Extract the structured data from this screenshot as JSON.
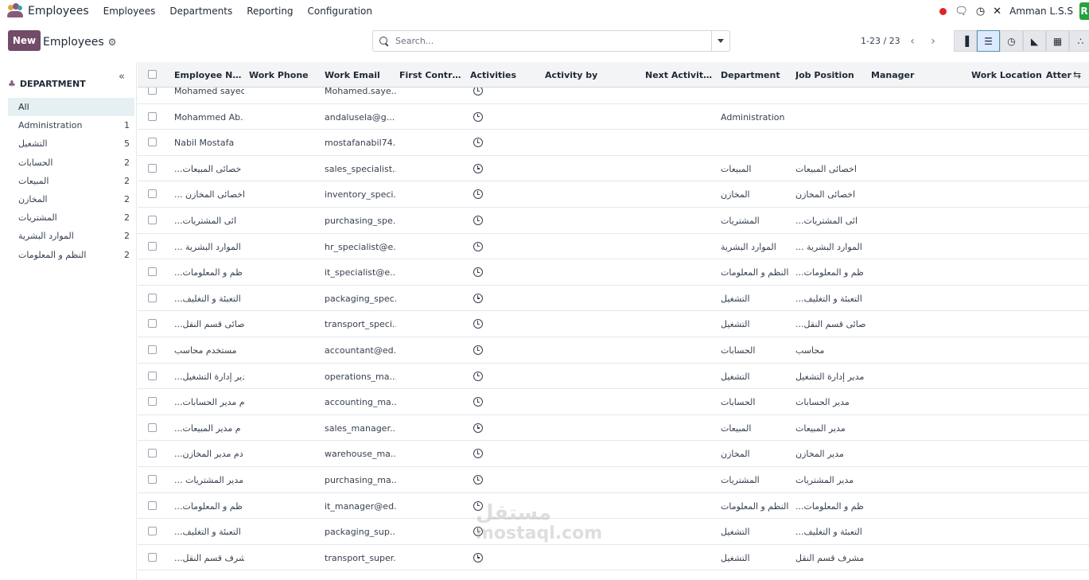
{
  "topnav": {
    "app_name": "Employees",
    "menu": [
      "Employees",
      "Departments",
      "Reporting",
      "Configuration"
    ],
    "company": "Amman L.S.S",
    "avatar_letter": "R"
  },
  "control": {
    "new_label": "New",
    "breadcrumb": "Employees",
    "search_placeholder": "Search...",
    "pager": "1-23 / 23"
  },
  "sidebar": {
    "header": "DEPARTMENT",
    "items": [
      {
        "label": "All",
        "count": ""
      },
      {
        "label": "Administration",
        "count": "1"
      },
      {
        "label": "التشغيل",
        "count": "5"
      },
      {
        "label": "الحسابات",
        "count": "2"
      },
      {
        "label": "المبيعات",
        "count": "2"
      },
      {
        "label": "المخازن",
        "count": "2"
      },
      {
        "label": "المشتريات",
        "count": "2"
      },
      {
        "label": "الموارد البشرية",
        "count": "2"
      },
      {
        "label": "النظم و المعلومات",
        "count": "2"
      }
    ]
  },
  "table": {
    "columns": [
      "Employee Name",
      "Work Phone",
      "Work Email",
      "First Contract ...",
      "Activities",
      "Activity by",
      "Next Activity D...",
      "Department",
      "Job Position",
      "Manager",
      "Work Location",
      "Atter"
    ],
    "rows": [
      {
        "name": "Mohamed sayed",
        "email": "Mohamed.saye...",
        "department": "",
        "job": ""
      },
      {
        "name": "Mohammed Ab...",
        "email": "andalusela@g...",
        "department": "Administration",
        "job": ""
      },
      {
        "name": "Nabil Mostafa",
        "email": "mostafanabil74...",
        "department": "",
        "job": ""
      },
      {
        "name": "...خصائى المبيعات",
        "email": "sales_specialist...",
        "department": "المبيعات",
        "job": "اخصائى المبيعات"
      },
      {
        "name": "... اخصائى المخازن",
        "email": "inventory_speci...",
        "department": "المخازن",
        "job": "اخصائى المخازن"
      },
      {
        "name": "...ائى المشتريات",
        "email": "purchasing_spe...",
        "department": "المشتريات",
        "job": "...ائى المشتريات"
      },
      {
        "name": "... الموارد البشرية",
        "email": "hr_specialist@e...",
        "department": "الموارد البشرية",
        "job": "... الموارد البشرية"
      },
      {
        "name": "...ظم و المعلومات",
        "email": "it_specialist@e...",
        "department": "النظم و المعلومات",
        "job": "...ظم و المعلومات"
      },
      {
        "name": "...التعبئة و التغليف",
        "email": "packaging_spec...",
        "department": "التشغيل",
        "job": "...التعبئة و التغليف"
      },
      {
        "name": "...صائى قسم النقل",
        "email": "transport_speci...",
        "department": "التشغيل",
        "job": "...صائى قسم النقل"
      },
      {
        "name": "مستخدم محاسب",
        "email": "accountant@ed...",
        "department": "الحسابات",
        "job": "محاسب"
      },
      {
        "name": "...دير إدارة التشغيل",
        "email": "operations_ma...",
        "department": "التشغيل",
        "job": "مدير إدارة التشغيل"
      },
      {
        "name": "...م مدير الحسابات",
        "email": "accounting_ma...",
        "department": "الحسابات",
        "job": "مدير الحسابات"
      },
      {
        "name": "...م مدير المبيعات",
        "email": "sales_manager...",
        "department": "المبيعات",
        "job": "مدير المبيعات"
      },
      {
        "name": "...دم مدير المخازن",
        "email": "warehouse_ma...",
        "department": "المخازن",
        "job": "مدير المخازن"
      },
      {
        "name": "... مدير المشتريات",
        "email": "purchasing_ma...",
        "department": "المشتريات",
        "job": "مدير المشتريات"
      },
      {
        "name": "...ظم و المعلومات",
        "email": "it_manager@ed...",
        "department": "النظم و المعلومات",
        "job": "...ظم و المعلومات"
      },
      {
        "name": "...التعبئة و التغليف",
        "email": "packaging_sup...",
        "department": "التشغيل",
        "job": "...التعبئة و التغليف"
      },
      {
        "name": "...شرف قسم النقل",
        "email": "transport_super...",
        "department": "التشغيل",
        "job": "مشرف قسم النقل"
      }
    ]
  },
  "watermark": {
    "line1": "مستقل",
    "line2": "mostaql.com"
  }
}
